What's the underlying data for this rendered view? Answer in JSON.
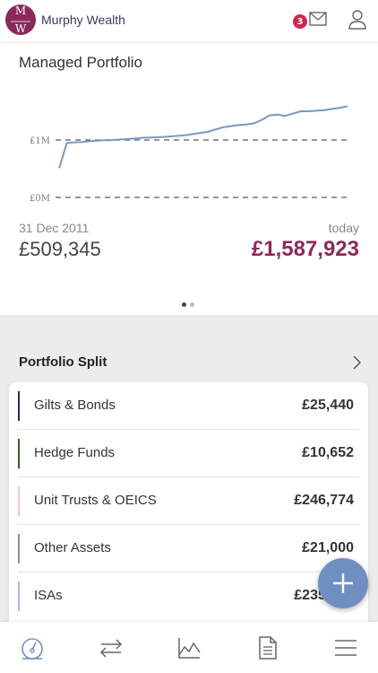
{
  "header": {
    "logo_top": "M",
    "logo_bottom": "W",
    "brand": "Murphy Wealth",
    "notification_count": "3",
    "icons": [
      "mail-icon",
      "user-icon"
    ]
  },
  "portfolio": {
    "title": "Managed Portfolio",
    "start_date": "31 Dec 2011",
    "start_value": "£509,345",
    "today_label": "today",
    "today_value": "£1,587,923",
    "accent_color": "#8a2a5a",
    "line_color": "#7b98c2",
    "pages": 2,
    "active_page": 1
  },
  "chart_data": {
    "type": "line",
    "y_ticks": [
      "£1M",
      "£0M"
    ],
    "y_tick_values": [
      1000000,
      0
    ],
    "series": [
      {
        "values": [
          509345,
          950000,
          960000,
          965000,
          980000,
          990000,
          995000,
          1000000,
          1010000,
          1020000,
          1030000,
          1040000,
          1045000,
          1050000,
          1060000,
          1070000,
          1080000,
          1100000,
          1120000,
          1140000,
          1180000,
          1220000,
          1240000,
          1260000,
          1270000,
          1290000,
          1350000,
          1430000,
          1440000,
          1420000,
          1460000,
          1500000,
          1500000,
          1510000,
          1520000,
          1540000,
          1560000,
          1587923
        ]
      }
    ]
  },
  "split": {
    "title": "Portfolio Split",
    "rows": [
      {
        "label": "Gilts & Bonds",
        "value": "£25,440",
        "color": "#2d2a5a"
      },
      {
        "label": "Hedge Funds",
        "value": "£10,652",
        "color": "#3d5a2a"
      },
      {
        "label": "Unit Trusts & OEICS",
        "value": "£246,774",
        "color": "#f0c8cc"
      },
      {
        "label": "Other Assets",
        "value": "£21,000",
        "color": "#8a8fa0"
      },
      {
        "label": "ISAs",
        "value": "£235,140",
        "color": "#b9b2dc"
      }
    ]
  },
  "fab": {
    "icon": "plus-icon",
    "color": "#6f8fc2"
  },
  "tabbar": {
    "items": [
      "dashboard-gauge-icon",
      "transfer-arrows-icon",
      "performance-chart-icon",
      "document-icon",
      "menu-icon"
    ]
  }
}
